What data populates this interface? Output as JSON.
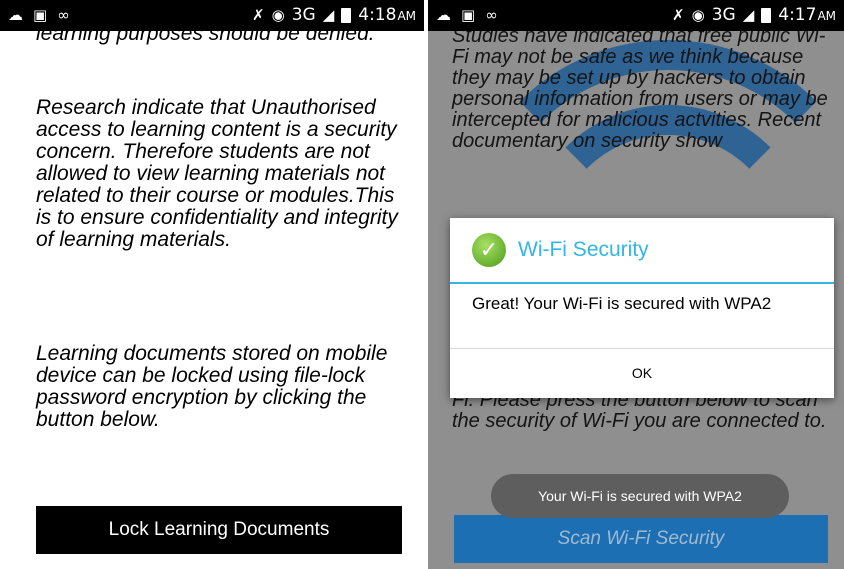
{
  "left": {
    "status_bar": {
      "icons": [
        "cloud-upload-icon",
        "image-icon",
        "voicemail-icon"
      ],
      "right_icons": [
        "mute-icon",
        "wifi-icon",
        "signal-icon",
        "battery-icon"
      ],
      "network": "3G",
      "time": "4:18",
      "ampm": "AM"
    },
    "paragraphs": [
      "learning purposes should be denied.",
      "Research indicate that Unauthorised access to learning content is a security concern. Therefore students are not allowed to view learning materials not related to their course or modules.This is to ensure confidentiality and integrity of learning materials.",
      "Learning documents stored on mobile device can be locked using file-lock password encryption by clicking the button below."
    ],
    "button_label": "Lock Learning Documents"
  },
  "right": {
    "status_bar": {
      "icons": [
        "cloud-upload-icon",
        "image-icon",
        "voicemail-icon"
      ],
      "right_icons": [
        "mute-icon",
        "wifi-icon",
        "signal-icon",
        "battery-icon"
      ],
      "network": "3G",
      "time": "4:17",
      "ampm": "AM"
    },
    "text_top": "Studies have indicated that free public Wi-Fi may not be safe as we think because they may be set up by hackers to obtain personal information from users or may be intercepted for malicious actvities. Recent documentary on security show",
    "text_bottom": "Fi. Please press the button below to scan the security of Wi-Fi you are connected to.",
    "dialog": {
      "icon": "check-icon",
      "title": "Wi-Fi Security",
      "message": "Great! Your Wi-Fi is secured with WPA2",
      "ok_label": "OK"
    },
    "toast": "Your Wi-Fi is secured with WPA2",
    "button_label": "Scan Wi-Fi Security"
  },
  "colors": {
    "dialog_accent": "#33b5e5",
    "scan_button": "#1d6fb3",
    "lock_button": "#000000"
  }
}
